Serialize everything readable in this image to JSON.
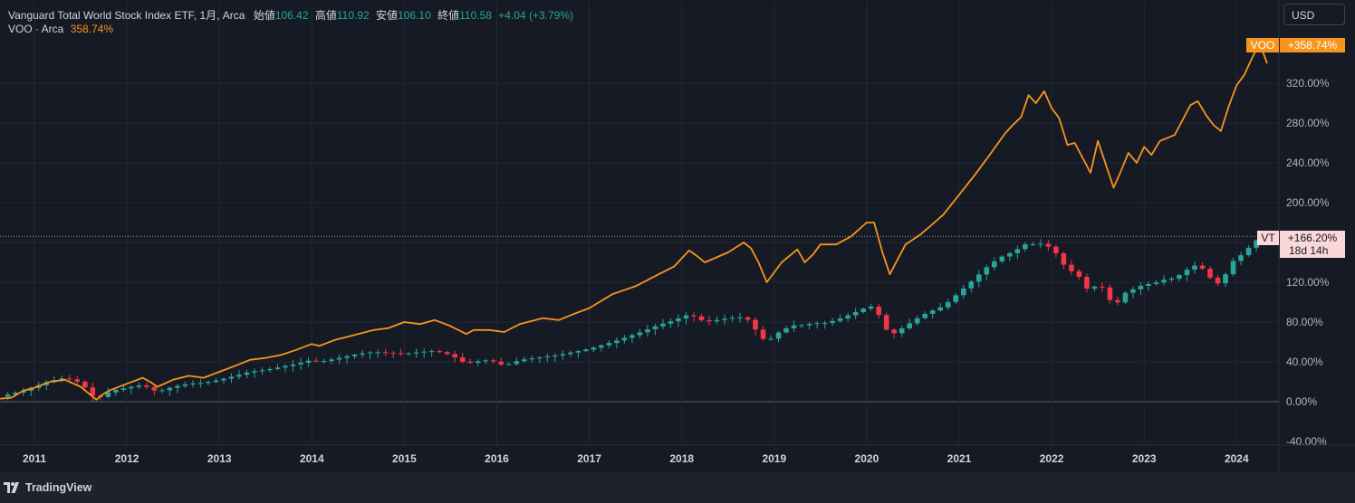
{
  "legend": {
    "symbol_title": "Vanguard Total World Stock Index ETF, 1月, Arca",
    "open_label": "始値",
    "open_value": "106.42",
    "high_label": "高値",
    "high_value": "110.92",
    "low_label": "安値",
    "low_value": "106.10",
    "close_label": "終値",
    "close_value": "110.58",
    "change": "+4.04 (+3.79%)",
    "compare_symbol": "VOO · Arca",
    "compare_value": "358.74%"
  },
  "toolbar": {
    "currency": "USD"
  },
  "footer": {
    "brand": "TradingView"
  },
  "chart_data": {
    "type": "line",
    "y_axis_unit": "%",
    "ylim": [
      -40,
      400
    ],
    "y_ticks": [
      "-40.00%",
      "0.00%",
      "40.00%",
      "80.00%",
      "120.00%",
      "160.00%",
      "200.00%",
      "240.00%",
      "280.00%",
      "320.00%"
    ],
    "x_ticks": [
      "2011",
      "2012",
      "2013",
      "2014",
      "2015",
      "2016",
      "2017",
      "2018",
      "2019",
      "2020",
      "2021",
      "2022",
      "2023",
      "2024"
    ],
    "x_range": [
      2010.6,
      2024.95
    ],
    "grid": true,
    "series": [
      {
        "name": "VOO",
        "style": "line",
        "color": "#f7941d",
        "last_label": "+358.74%",
        "x": [
          2010.63,
          2010.75,
          2010.88,
          2011.0,
          2011.17,
          2011.33,
          2011.5,
          2011.67,
          2011.75,
          2011.83,
          2012.0,
          2012.17,
          2012.25,
          2012.33,
          2012.5,
          2012.67,
          2012.83,
          2013.0,
          2013.17,
          2013.33,
          2013.5,
          2013.67,
          2013.83,
          2014.0,
          2014.08,
          2014.25,
          2014.5,
          2014.67,
          2014.83,
          2015.0,
          2015.17,
          2015.33,
          2015.5,
          2015.67,
          2015.75,
          2015.92,
          2016.08,
          2016.25,
          2016.5,
          2016.67,
          2016.83,
          2017.0,
          2017.25,
          2017.5,
          2017.75,
          2017.92,
          2018.08,
          2018.17,
          2018.25,
          2018.5,
          2018.67,
          2018.75,
          2018.83,
          2018.92,
          2019.08,
          2019.25,
          2019.33,
          2019.42,
          2019.5,
          2019.67,
          2019.83,
          2020.0,
          2020.08,
          2020.17,
          2020.25,
          2020.42,
          2020.58,
          2020.67,
          2020.83,
          2021.0,
          2021.17,
          2021.33,
          2021.5,
          2021.58,
          2021.67,
          2021.75,
          2021.83,
          2021.92,
          2022.0,
          2022.08,
          2022.17,
          2022.25,
          2022.42,
          2022.5,
          2022.67,
          2022.75,
          2022.83,
          2022.92,
          2023.0,
          2023.08,
          2023.17,
          2023.33,
          2023.5,
          2023.58,
          2023.67,
          2023.75,
          2023.83,
          2023.92,
          2024.0,
          2024.08,
          2024.17,
          2024.25,
          2024.33
        ],
        "y": [
          3,
          4,
          11,
          14,
          20,
          22,
          15,
          2,
          8,
          12,
          18,
          24,
          20,
          15,
          22,
          26,
          24,
          30,
          36,
          42,
          44,
          47,
          52,
          58,
          56,
          62,
          68,
          72,
          74,
          80,
          78,
          82,
          76,
          68,
          72,
          72,
          70,
          78,
          84,
          82,
          88,
          94,
          108,
          116,
          128,
          136,
          152,
          146,
          140,
          150,
          160,
          154,
          140,
          120,
          140,
          153,
          140,
          148,
          158,
          158,
          166,
          180,
          180,
          150,
          128,
          158,
          168,
          175,
          188,
          208,
          228,
          248,
          270,
          278,
          286,
          308,
          300,
          312,
          295,
          285,
          258,
          260,
          230,
          262,
          215,
          232,
          250,
          240,
          256,
          248,
          262,
          268,
          298,
          302,
          288,
          278,
          272,
          298,
          318,
          328,
          346,
          360,
          340
        ]
      },
      {
        "name": "VT",
        "style": "candlestick",
        "color_up": "#26a69a",
        "color_down": "#f23645",
        "last_label": "+166.20%",
        "countdown": "18d 14h",
        "x": [
          2010.63,
          2010.75,
          2010.88,
          2011.0,
          2011.17,
          2011.33,
          2011.5,
          2011.67,
          2011.75,
          2011.83,
          2012.0,
          2012.17,
          2012.25,
          2012.33,
          2012.5,
          2012.67,
          2012.83,
          2013.0,
          2013.17,
          2013.33,
          2013.5,
          2013.67,
          2013.83,
          2014.0,
          2014.08,
          2014.25,
          2014.5,
          2014.67,
          2014.83,
          2015.0,
          2015.17,
          2015.33,
          2015.5,
          2015.67,
          2015.75,
          2015.92,
          2016.08,
          2016.25,
          2016.5,
          2016.67,
          2016.83,
          2017.0,
          2017.25,
          2017.5,
          2017.75,
          2017.92,
          2018.08,
          2018.17,
          2018.25,
          2018.5,
          2018.67,
          2018.75,
          2018.83,
          2018.92,
          2019.08,
          2019.25,
          2019.33,
          2019.42,
          2019.5,
          2019.67,
          2019.83,
          2020.0,
          2020.08,
          2020.17,
          2020.25,
          2020.42,
          2020.58,
          2020.67,
          2020.83,
          2021.0,
          2021.17,
          2021.33,
          2021.5,
          2021.58,
          2021.67,
          2021.75,
          2021.83,
          2021.92,
          2022.0,
          2022.08,
          2022.17,
          2022.25,
          2022.42,
          2022.5,
          2022.67,
          2022.75,
          2022.83,
          2022.92,
          2023.0,
          2023.08,
          2023.17,
          2023.33,
          2023.5,
          2023.58,
          2023.67,
          2023.75,
          2023.83,
          2023.92,
          2024.0,
          2024.08,
          2024.17,
          2024.25,
          2024.33
        ],
        "y": [
          5,
          8,
          11,
          15,
          21,
          24,
          19,
          2,
          7,
          11,
          14,
          17,
          13,
          10,
          15,
          18,
          19,
          22,
          26,
          30,
          32,
          35,
          38,
          42,
          40,
          43,
          48,
          50,
          49,
          48,
          50,
          51,
          47,
          38,
          40,
          42,
          36,
          42,
          45,
          47,
          50,
          53,
          60,
          68,
          77,
          82,
          88,
          84,
          80,
          84,
          85,
          80,
          67,
          60,
          72,
          78,
          76,
          80,
          78,
          82,
          88,
          95,
          96,
          80,
          66,
          76,
          86,
          90,
          96,
          110,
          124,
          138,
          148,
          150,
          156,
          160,
          157,
          160,
          152,
          147,
          130,
          132,
          108,
          122,
          96,
          103,
          114,
          112,
          120,
          117,
          122,
          124,
          135,
          138,
          130,
          120,
          118,
          136,
          146,
          148,
          160,
          164,
          166
        ]
      }
    ]
  }
}
